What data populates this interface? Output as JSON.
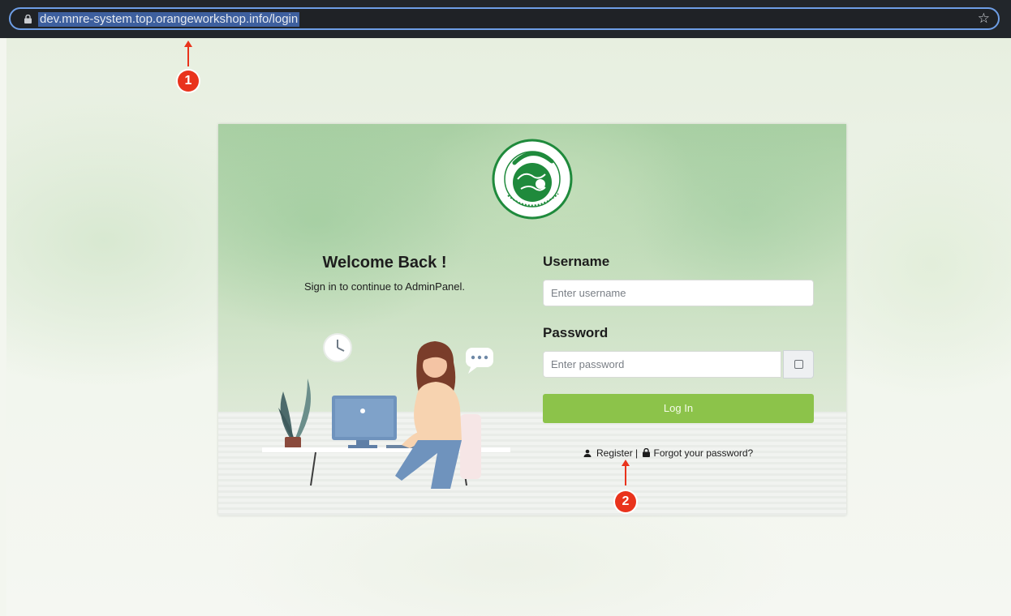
{
  "browser": {
    "url": "dev.mnre-system.top.orangeworkshop.info/login",
    "icons": {
      "lock": "lock-icon",
      "bookmark": "star-icon"
    }
  },
  "annotations": {
    "marker_1": "1",
    "marker_2": "2",
    "color": "#e9331c"
  },
  "card": {
    "logo": {
      "thai_text": "ฉลากเขียว",
      "english_text": "GREEN LABEL : THAILAND"
    },
    "welcome_title": "Welcome Back !",
    "welcome_subtitle": "Sign in to continue to AdminPanel.",
    "form": {
      "username_label": "Username",
      "username_placeholder": "Enter username",
      "password_label": "Password",
      "password_placeholder": "Enter password",
      "login_button": "Log In",
      "register_link": "Register",
      "separator": "|",
      "forgot_link": "Forgot your password?"
    }
  },
  "colors": {
    "accent_green": "#8cc34a",
    "logo_green": "#1f8a3c",
    "url_highlight": "#3d5f9e"
  }
}
